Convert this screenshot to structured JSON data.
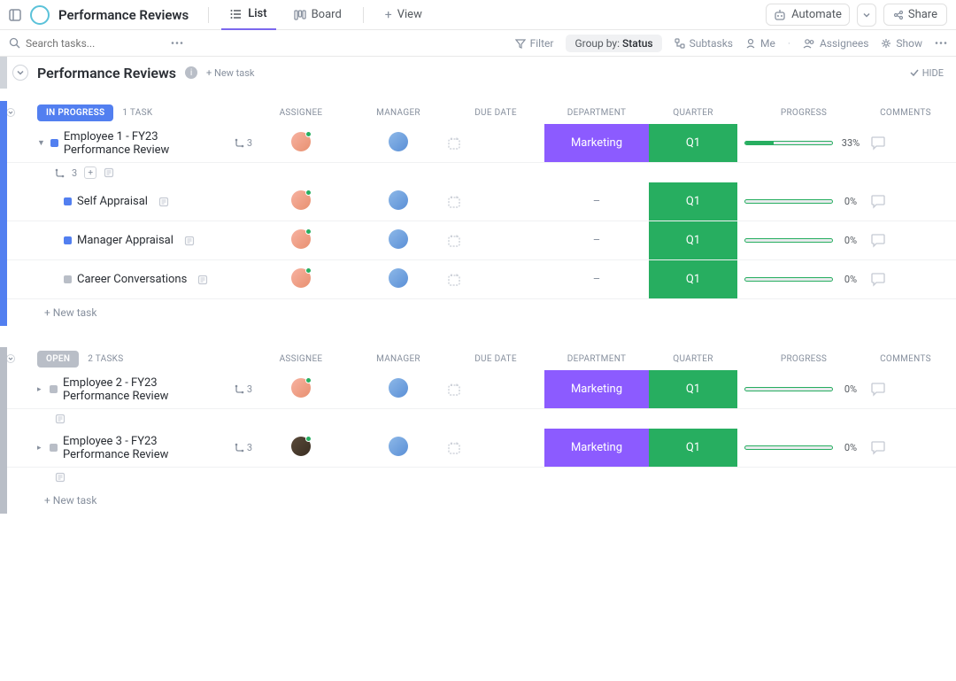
{
  "header": {
    "workspace": "Performance Reviews",
    "tabs": [
      {
        "label": "List",
        "icon": "list-icon",
        "active": true
      },
      {
        "label": "Board",
        "icon": "board-icon",
        "active": false
      },
      {
        "label": "View",
        "icon": "plus-icon",
        "active": false
      }
    ],
    "automate": "Automate",
    "share": "Share"
  },
  "toolbar": {
    "search_placeholder": "Search tasks...",
    "filter": "Filter",
    "group_prefix": "Group by:",
    "group_value": "Status",
    "subtasks": "Subtasks",
    "me": "Me",
    "assignees": "Assignees",
    "show": "Show"
  },
  "section": {
    "title": "Performance Reviews",
    "new_task": "+ New task",
    "hide": "HIDE"
  },
  "columns": {
    "assignee": "ASSIGNEE",
    "manager": "MANAGER",
    "due": "DUE DATE",
    "department": "DEPARTMENT",
    "quarter": "QUARTER",
    "progress": "PROGRESS",
    "comments": "COMMENTS"
  },
  "groups": [
    {
      "status": "IN PROGRESS",
      "status_color": "#527ff0",
      "count_label": "1 TASK",
      "tasks": [
        {
          "title": "Employee 1 - FY23 Performance Review",
          "subtask_count": "3",
          "assignee": "a1",
          "manager": "a2",
          "department": "Marketing",
          "quarter": "Q1",
          "progress_pct": "33%",
          "progress_fill": 33,
          "expanded": true,
          "subtasks": [
            {
              "title": "Self Appraisal",
              "status": "blue",
              "assignee": "a1",
              "manager": "a2",
              "department": "–",
              "quarter": "Q1",
              "progress_pct": "0%",
              "progress_fill": 0
            },
            {
              "title": "Manager Appraisal",
              "status": "blue",
              "assignee": "a1",
              "manager": "a2",
              "department": "–",
              "quarter": "Q1",
              "progress_pct": "0%",
              "progress_fill": 0
            },
            {
              "title": "Career Conversations",
              "status": "gray",
              "assignee": "a1",
              "manager": "a2",
              "department": "–",
              "quarter": "Q1",
              "progress_pct": "0%",
              "progress_fill": 0
            }
          ]
        }
      ],
      "new_task": "+ New task"
    },
    {
      "status": "OPEN",
      "status_color": "#b9bec7",
      "count_label": "2 TASKS",
      "tasks": [
        {
          "title": "Employee 2 - FY23 Performance Review",
          "subtask_count": "3",
          "assignee": "a1",
          "manager": "a2",
          "department": "Marketing",
          "quarter": "Q1",
          "progress_pct": "0%",
          "progress_fill": 0,
          "expanded": false
        },
        {
          "title": "Employee 3 - FY23 Performance Review",
          "subtask_count": "3",
          "assignee": "a3",
          "manager": "a2",
          "department": "Marketing",
          "quarter": "Q1",
          "progress_pct": "0%",
          "progress_fill": 0,
          "expanded": false
        }
      ],
      "new_task": "+ New task"
    }
  ]
}
